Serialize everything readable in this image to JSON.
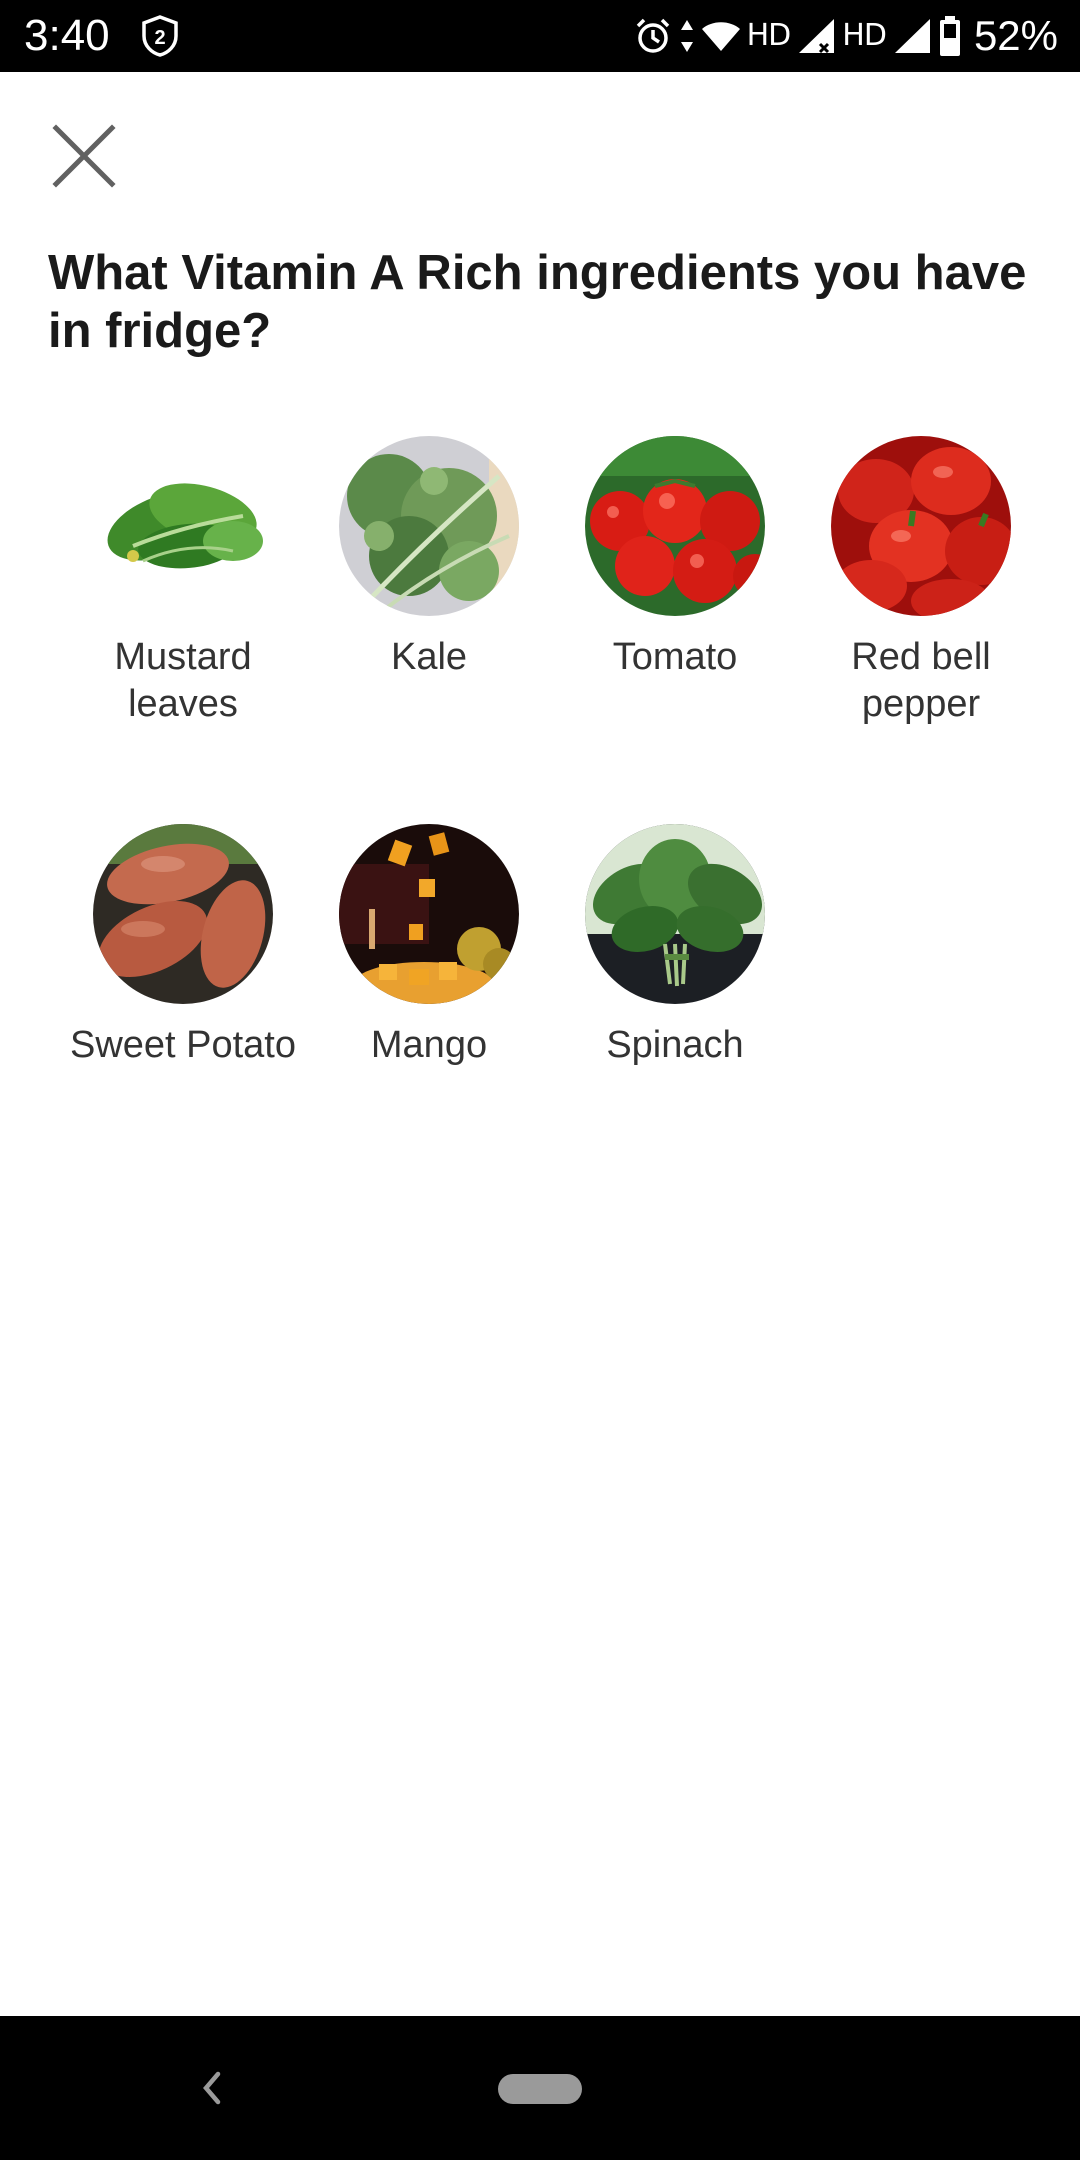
{
  "status_bar": {
    "time": "3:40",
    "notification_badge": "2",
    "network_left_label": "HD",
    "network_right_label": "HD",
    "battery_percent": "52%",
    "icons": [
      "shield-icon",
      "alarm-icon",
      "data-arrows-icon",
      "wifi-icon",
      "signal-icon",
      "signal-icon",
      "battery-icon"
    ],
    "background_color": "#000000"
  },
  "header": {
    "close_icon": "close-icon",
    "title": "What Vitamin A Rich ingredients you have in fridge?"
  },
  "ingredients": [
    {
      "label": "Mustard leaves",
      "image": "mustard-leaves-photo"
    },
    {
      "label": "Kale",
      "image": "kale-photo"
    },
    {
      "label": "Tomato",
      "image": "tomato-photo"
    },
    {
      "label": "Red bell pepper",
      "image": "red-bell-pepper-photo"
    },
    {
      "label": "Sweet Potato",
      "image": "sweet-potato-photo"
    },
    {
      "label": "Mango",
      "image": "mango-photo"
    },
    {
      "label": "Spinach",
      "image": "spinach-photo"
    }
  ],
  "nav_bar": {
    "icons": [
      "back-icon",
      "home-pill-icon"
    ],
    "background_color": "#000000"
  }
}
